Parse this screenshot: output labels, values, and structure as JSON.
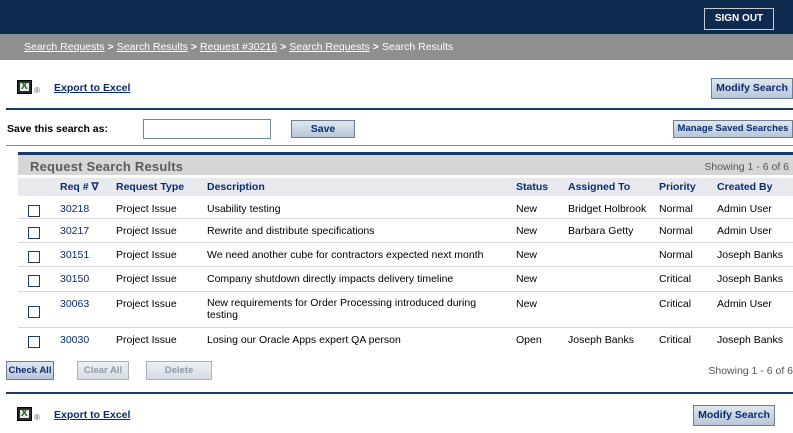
{
  "header": {
    "signout_label": "SIGN OUT"
  },
  "breadcrumb": {
    "items": [
      "Search Requests",
      "Search Results",
      "Request #30216",
      "Search Requests"
    ],
    "current": "Search Results",
    "separator": ">"
  },
  "export_label": "Export to Excel",
  "excel_icon_symbol": "®",
  "modify_search_label": "Modify Search",
  "save_search": {
    "label": "Save this search as:",
    "value": "",
    "save_label": "Save",
    "manage_label": "Manage Saved Searches"
  },
  "results": {
    "title": "Request Search Results",
    "count_text": "Showing 1 - 6 of 6",
    "columns": {
      "req": "Req # ∇",
      "type": "Request Type",
      "description": "Description",
      "status": "Status",
      "assigned": "Assigned To",
      "priority": "Priority",
      "created": "Created By"
    },
    "rows": [
      {
        "req": "30218",
        "type": "Project Issue",
        "description": "Usability testing",
        "status": "New",
        "assigned": "Bridget Holbrook",
        "priority": "Normal",
        "created": "Admin User"
      },
      {
        "req": "30217",
        "type": "Project Issue",
        "description": "Rewrite and distribute specifications",
        "status": "New",
        "assigned": "Barbara Getty",
        "priority": "Normal",
        "created": "Admin User"
      },
      {
        "req": "30151",
        "type": "Project Issue",
        "description": "We need another cube for contractors expected next month",
        "status": "New",
        "assigned": "",
        "priority": "Normal",
        "created": "Joseph Banks"
      },
      {
        "req": "30150",
        "type": "Project Issue",
        "description": "Company shutdown directly impacts delivery timeline",
        "status": "New",
        "assigned": "",
        "priority": "Critical",
        "created": "Joseph Banks"
      },
      {
        "req": "30063",
        "type": "Project Issue",
        "description": "New requirements for Order Processing introduced during testing",
        "status": "New",
        "assigned": "",
        "priority": "Critical",
        "created": "Admin User"
      },
      {
        "req": "30030",
        "type": "Project Issue",
        "description": "Losing our Oracle Apps expert QA person",
        "status": "Open",
        "assigned": "Joseph Banks",
        "priority": "Critical",
        "created": "Joseph Banks"
      }
    ]
  },
  "actions": {
    "check_all": "Check All",
    "clear_all": "Clear All",
    "delete": "Delete"
  }
}
